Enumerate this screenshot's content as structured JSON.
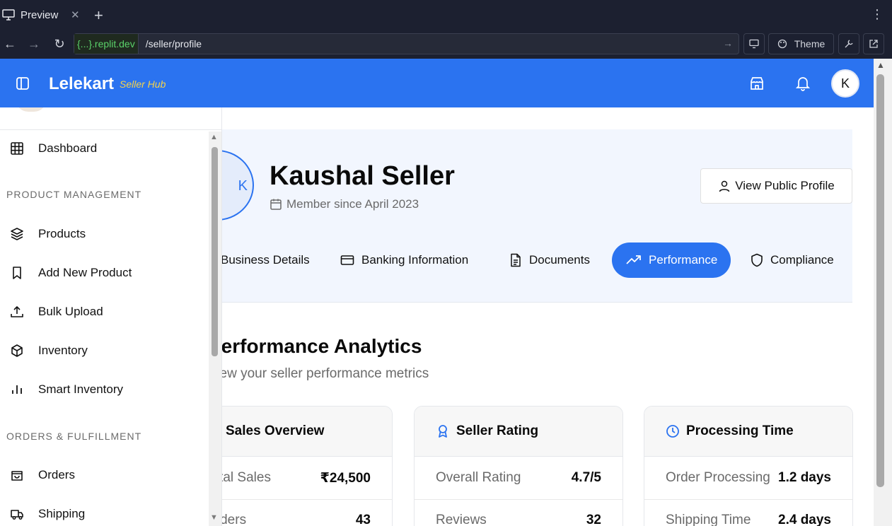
{
  "browser": {
    "tab_title": "Preview",
    "url_badge": "{...}.replit.dev",
    "url_path": "/seller/profile",
    "theme_label": "Theme"
  },
  "header": {
    "brand": "Lelekart",
    "brand_sub": "Seller Hub",
    "avatar_initial": "K",
    "colors": {
      "primary": "#2b73f0",
      "accent": "#f5d34a"
    }
  },
  "sidebar": {
    "items": [
      {
        "label": "Dashboard",
        "icon": "grid-icon"
      },
      {
        "label": "Products",
        "icon": "layers-icon"
      },
      {
        "label": "Add New Product",
        "icon": "bookmark-icon"
      },
      {
        "label": "Bulk Upload",
        "icon": "upload-icon"
      },
      {
        "label": "Inventory",
        "icon": "package-icon"
      },
      {
        "label": "Smart Inventory",
        "icon": "bar-chart-icon"
      },
      {
        "label": "Orders",
        "icon": "shopping-bag-icon"
      },
      {
        "label": "Shipping",
        "icon": "truck-icon"
      }
    ],
    "sections": [
      "PRODUCT MANAGEMENT",
      "ORDERS & FULFILLMENT"
    ]
  },
  "profile": {
    "name": "Kaushal Seller",
    "since": "Member since April 2023",
    "view_public": "View Public Profile",
    "avatar_initial": "K"
  },
  "tabs": [
    {
      "label": "Business Details",
      "icon": "building-icon"
    },
    {
      "label": "Banking Information",
      "icon": "credit-card-icon"
    },
    {
      "label": "Documents",
      "icon": "file-text-icon"
    },
    {
      "label": "Performance",
      "icon": "trending-up-icon",
      "active": true
    },
    {
      "label": "Compliance",
      "icon": "shield-icon"
    }
  ],
  "performance": {
    "title": "Performance Analytics",
    "subtitle": "View your seller performance metrics",
    "cards": [
      {
        "title": "Sales Overview",
        "icon": "bar-chart-icon",
        "rows": [
          {
            "label": "Total Sales",
            "value": "₹24,500"
          },
          {
            "label": "Orders",
            "value": "43"
          }
        ]
      },
      {
        "title": "Seller Rating",
        "icon": "award-icon",
        "rows": [
          {
            "label": "Overall Rating",
            "value": "4.7/5"
          },
          {
            "label": "Reviews",
            "value": "32"
          }
        ]
      },
      {
        "title": "Processing Time",
        "icon": "clock-icon",
        "rows": [
          {
            "label": "Order Processing",
            "value": "1.2 days"
          },
          {
            "label": "Shipping Time",
            "value": "2.4 days"
          }
        ]
      }
    ]
  }
}
